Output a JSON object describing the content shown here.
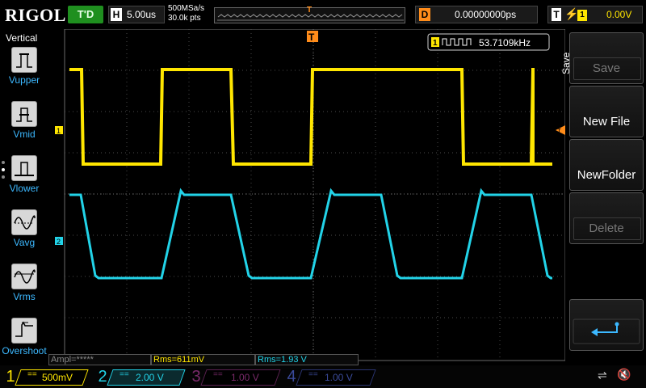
{
  "header": {
    "logo": "RIGOL",
    "run_status": "T'D",
    "timebase_label": "H",
    "timebase_value": "5.00us",
    "sample_rate": "500MSa/s",
    "memory_depth": "30.0k pts",
    "trigger_pos_marker": "T",
    "delay_label": "D",
    "delay_value": "0.00000000ps",
    "trigger_label": "T",
    "trigger_edge": "f",
    "trigger_source": "1",
    "trigger_level": "0.00V"
  },
  "left_menu": {
    "title": "Vertical",
    "items": [
      {
        "label": "Vupper",
        "icon": "vupper-icon"
      },
      {
        "label": "Vmid",
        "icon": "vmid-icon"
      },
      {
        "label": "Vlower",
        "icon": "vlower-icon"
      },
      {
        "label": "Vavg",
        "icon": "vavg-icon"
      },
      {
        "label": "Vrms",
        "icon": "vrms-icon"
      },
      {
        "label": "Overshoot",
        "icon": "overshoot-icon"
      }
    ]
  },
  "right_menu": {
    "title": "Save",
    "buttons": [
      {
        "label": "Save",
        "enabled": false
      },
      {
        "label": "New File",
        "enabled": true
      },
      {
        "label": "NewFolder",
        "enabled": true
      },
      {
        "label": "Delete",
        "enabled": false
      },
      {
        "label": "",
        "enabled": true,
        "icon": "return-arrow-icon"
      }
    ]
  },
  "waveform": {
    "frequency_badge_channel": "1",
    "frequency": "53.7109kHz",
    "ch1_marker": "1",
    "ch2_marker": "2",
    "trigger_marker": "T",
    "trigger_level_marker": "T"
  },
  "measurements": [
    {
      "text": "Ampl=*****",
      "color": "#888888"
    },
    {
      "text": "Rms=611mV",
      "color": "#ffe600"
    },
    {
      "text": "Rms=1.93 V",
      "color": "#22d3e8"
    }
  ],
  "channels": [
    {
      "num": "1",
      "coupling": "==",
      "scale": "500mV",
      "color": "#ffe600",
      "active": true
    },
    {
      "num": "2",
      "coupling": "==",
      "scale": "2.00 V",
      "color": "#22d3e8",
      "active": true
    },
    {
      "num": "3",
      "coupling": "==",
      "scale": "1.00 V",
      "color": "#7a2a6a",
      "active": false
    },
    {
      "num": "4",
      "coupling": "==",
      "scale": "1.00 V",
      "color": "#3a4a9a",
      "active": false
    }
  ],
  "colors": {
    "ch1": "#ffe600",
    "ch2": "#22d3e8",
    "trigger": "#ff8c1a",
    "grid": "#5a5a5a",
    "accent": "#3cb8ff"
  }
}
